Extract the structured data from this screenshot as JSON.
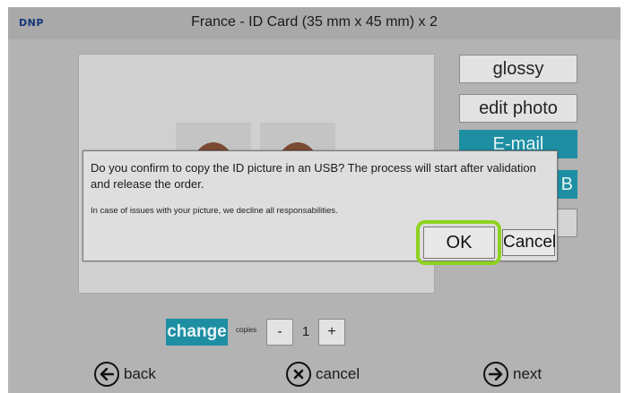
{
  "header": {
    "brand": "DNP",
    "title": "France - ID Card (35 mm x 45 mm) x 2"
  },
  "side_buttons": {
    "glossy": "glossy",
    "edit_photo": "edit photo",
    "email": "E-mail",
    "usb_partial": "B"
  },
  "dialog": {
    "message": "Do you confirm to copy the ID picture in an USB? The process will start after validation and release the order.",
    "disclaimer": "In case of issues with your picture, we decline all responsabilities.",
    "ok_label": "OK",
    "cancel_label": "Cancel"
  },
  "copies": {
    "change_label": "change",
    "label": "copies",
    "minus_label": "-",
    "count": "1",
    "plus_label": "+"
  },
  "nav": {
    "back_label": "back",
    "cancel_label": "cancel",
    "next_label": "next"
  },
  "colors": {
    "accent_teal": "#1e8fa3",
    "highlight_green": "#8dd21e",
    "brand_blue": "#15357a"
  }
}
